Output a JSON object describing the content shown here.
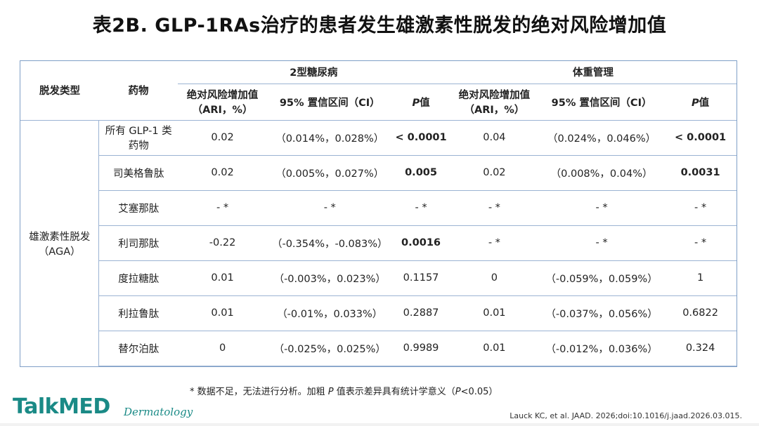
{
  "title": "表2B. GLP-1RAs治疗的患者发生雄激素性脱发的绝对风险增加值",
  "header": {
    "col_type": "脱发类型",
    "col_drug": "药物",
    "group1": "2型糖尿病",
    "group2": "体重管理",
    "ari": "绝对风险增加值",
    "ari_unit": "（ARI，%）",
    "ci": "95% 置信区间（CI）",
    "p_italic": "P",
    "p_suffix": "值"
  },
  "row_group_label_1": "雄激素性脱发",
  "row_group_label_2": "（AGA）",
  "rows": [
    {
      "drug1": "所有 GLP-1 类",
      "drug2": "药物",
      "t2_ari": "0.02",
      "t2_ci": "（0.014%，0.028%）",
      "t2_p": "< 0.0001",
      "t2_p_bold": true,
      "w_ari": "0.04",
      "w_ci": "（0.024%，0.046%）",
      "w_p": "< 0.0001",
      "w_p_bold": true
    },
    {
      "drug1": "司美格鲁肽",
      "drug2": "",
      "t2_ari": "0.02",
      "t2_ci": "（0.005%，0.027%）",
      "t2_p": "0.005",
      "t2_p_bold": true,
      "w_ari": "0.02",
      "w_ci": "（0.008%，0.04%）",
      "w_p": "0.0031",
      "w_p_bold": true
    },
    {
      "drug1": "艾塞那肽",
      "drug2": "",
      "t2_ari": "- *",
      "t2_ci": "- *",
      "t2_p": "- *",
      "t2_p_bold": false,
      "w_ari": "- *",
      "w_ci": "- *",
      "w_p": "- *",
      "w_p_bold": false
    },
    {
      "drug1": "利司那肽",
      "drug2": "",
      "t2_ari": "-0.22",
      "t2_ci": "（-0.354%，-0.083%）",
      "t2_p": "0.0016",
      "t2_p_bold": true,
      "w_ari": "- *",
      "w_ci": "- *",
      "w_p": "- *",
      "w_p_bold": false
    },
    {
      "drug1": "度拉糖肽",
      "drug2": "",
      "t2_ari": "0.01",
      "t2_ci": "（-0.003%，0.023%）",
      "t2_p": "0.1157",
      "t2_p_bold": false,
      "w_ari": "0",
      "w_ci": "（-0.059%，0.059%）",
      "w_p": "1",
      "w_p_bold": false
    },
    {
      "drug1": "利拉鲁肽",
      "drug2": "",
      "t2_ari": "0.01",
      "t2_ci": "（-0.01%，0.033%）",
      "t2_p": "0.2887",
      "t2_p_bold": false,
      "w_ari": "0.01",
      "w_ci": "（-0.037%，0.056%）",
      "w_p": "0.6822",
      "w_p_bold": false
    },
    {
      "drug1": "替尔泊肽",
      "drug2": "",
      "t2_ari": "0",
      "t2_ci": "（-0.025%，0.025%）",
      "t2_p": "0.9989",
      "t2_p_bold": false,
      "w_ari": "0.01",
      "w_ci": "（-0.012%，0.036%）",
      "w_p": "0.324",
      "w_p_bold": false
    }
  ],
  "footnote_1": "* 数据不足，无法进行分析。加粗 ",
  "footnote_p": "P",
  "footnote_2": " 值表示差异具有统计学意义（",
  "footnote_p2": "P",
  "footnote_3": "<0.05）",
  "logo_talk": "TalkMED",
  "logo_sub": "Dermatology",
  "citation": "Lauck KC, et al. JAAD. 2026;doi:10.1016/j.jaad.2026.03.015."
}
